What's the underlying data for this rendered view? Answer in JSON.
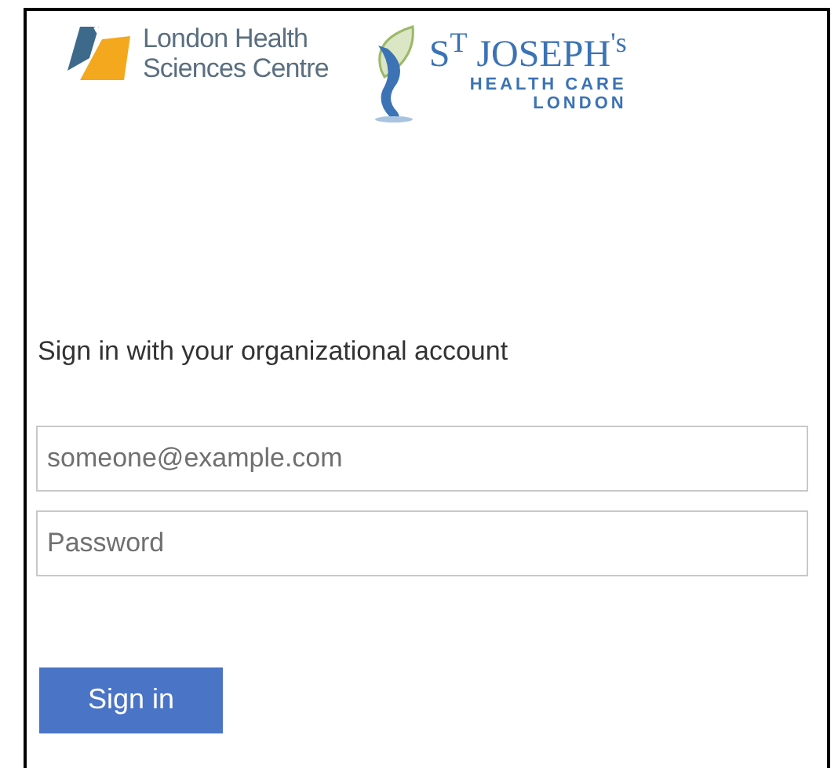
{
  "logos": [
    {
      "kind": "lhsc",
      "lines": [
        "London Health",
        "Sciences Centre"
      ]
    },
    {
      "kind": "sjhc",
      "lines": [
        "S$^{T}$ JOSEPH$^{'s}$",
        "HEALTH CARE",
        "LONDON"
      ]
    }
  ],
  "heading": "Sign in with your organizational account",
  "fields": [
    {
      "placeholder": "someone@example.com"
    },
    {
      "placeholder": "Password"
    }
  ],
  "button": "Sign in"
}
